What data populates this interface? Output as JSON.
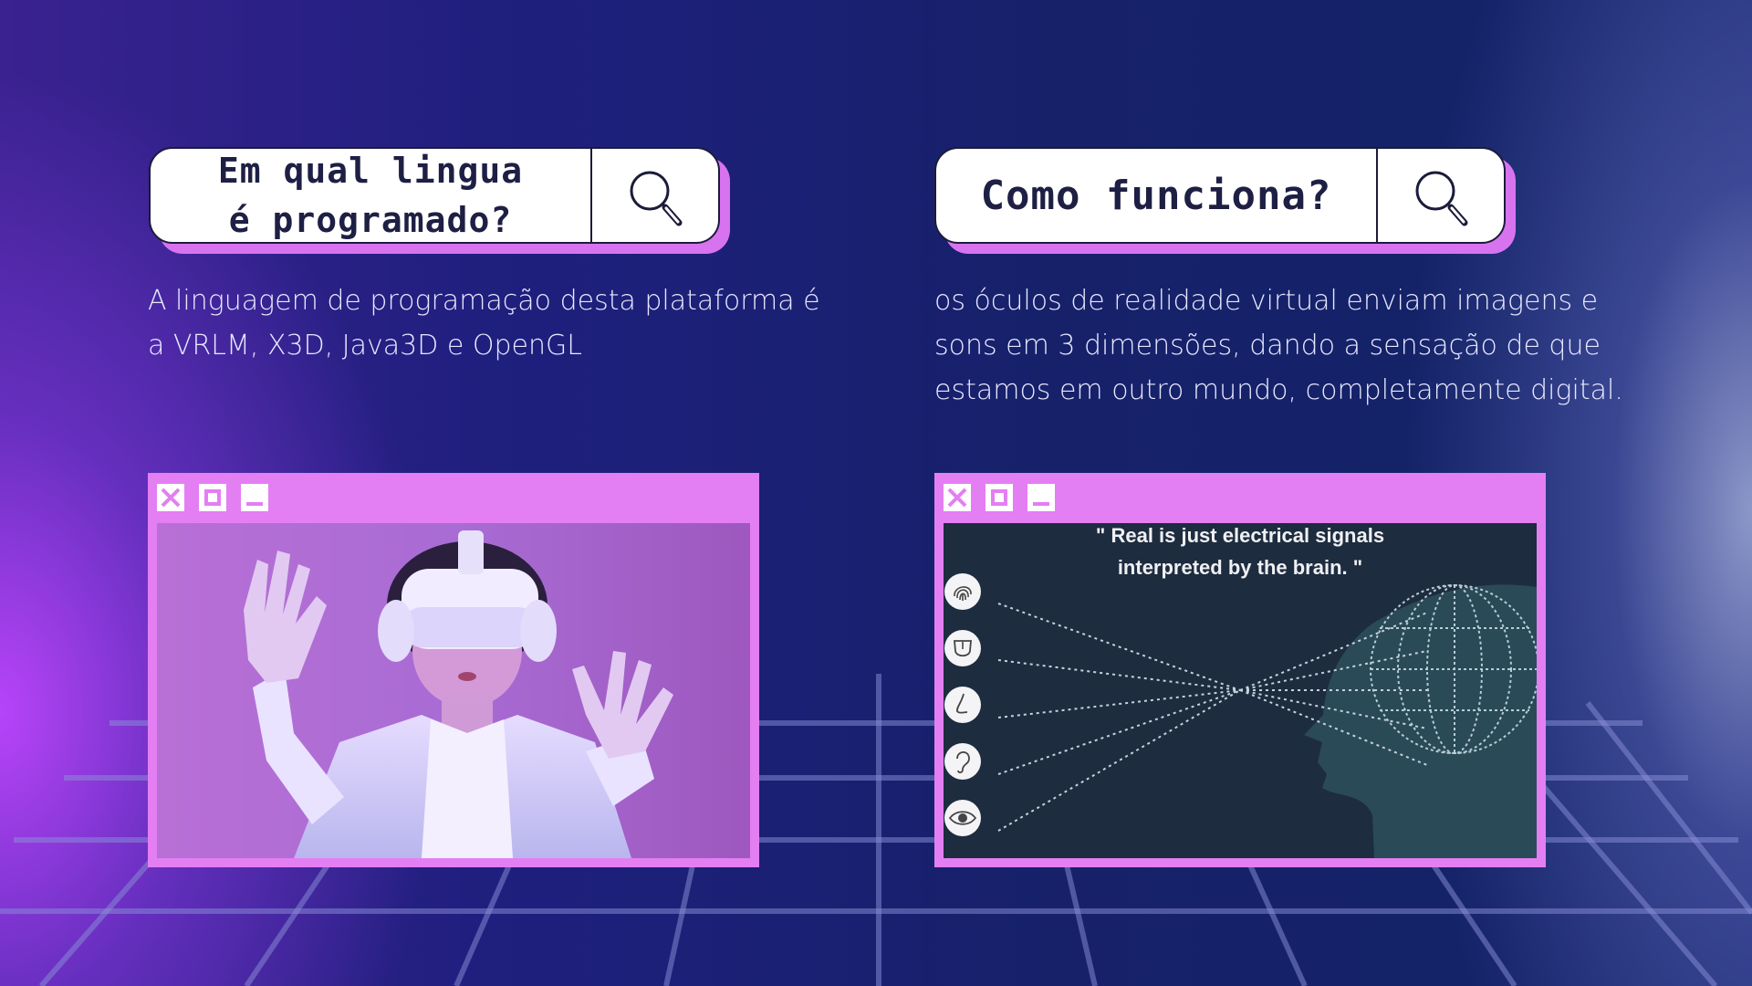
{
  "card_left": {
    "question": "Em qual lingua é programado?",
    "answer": "A linguagem de programação desta plataforma é a VRLM, X3D, Java3D e OpenGL"
  },
  "card_right": {
    "question": "Como funciona?",
    "answer": "os óculos de realidade virtual enviam imagens e sons em 3 dimensões, dando a sensação de que estamos em outro mundo, completamente digital.",
    "image_caption": "\" Real is just electrical signals interpreted by the brain. \""
  },
  "icons": {
    "search": "magnifier-icon",
    "close": "close-icon",
    "maximize": "maximize-icon",
    "minimize": "minimize-icon",
    "senses": [
      "fingerprint-icon",
      "tongue-icon",
      "nose-icon",
      "ear-icon",
      "eye-icon"
    ]
  },
  "colors": {
    "accent_pink": "#e47ef3",
    "navy_text": "#1e1f44",
    "body_text": "#e8e7ff"
  }
}
